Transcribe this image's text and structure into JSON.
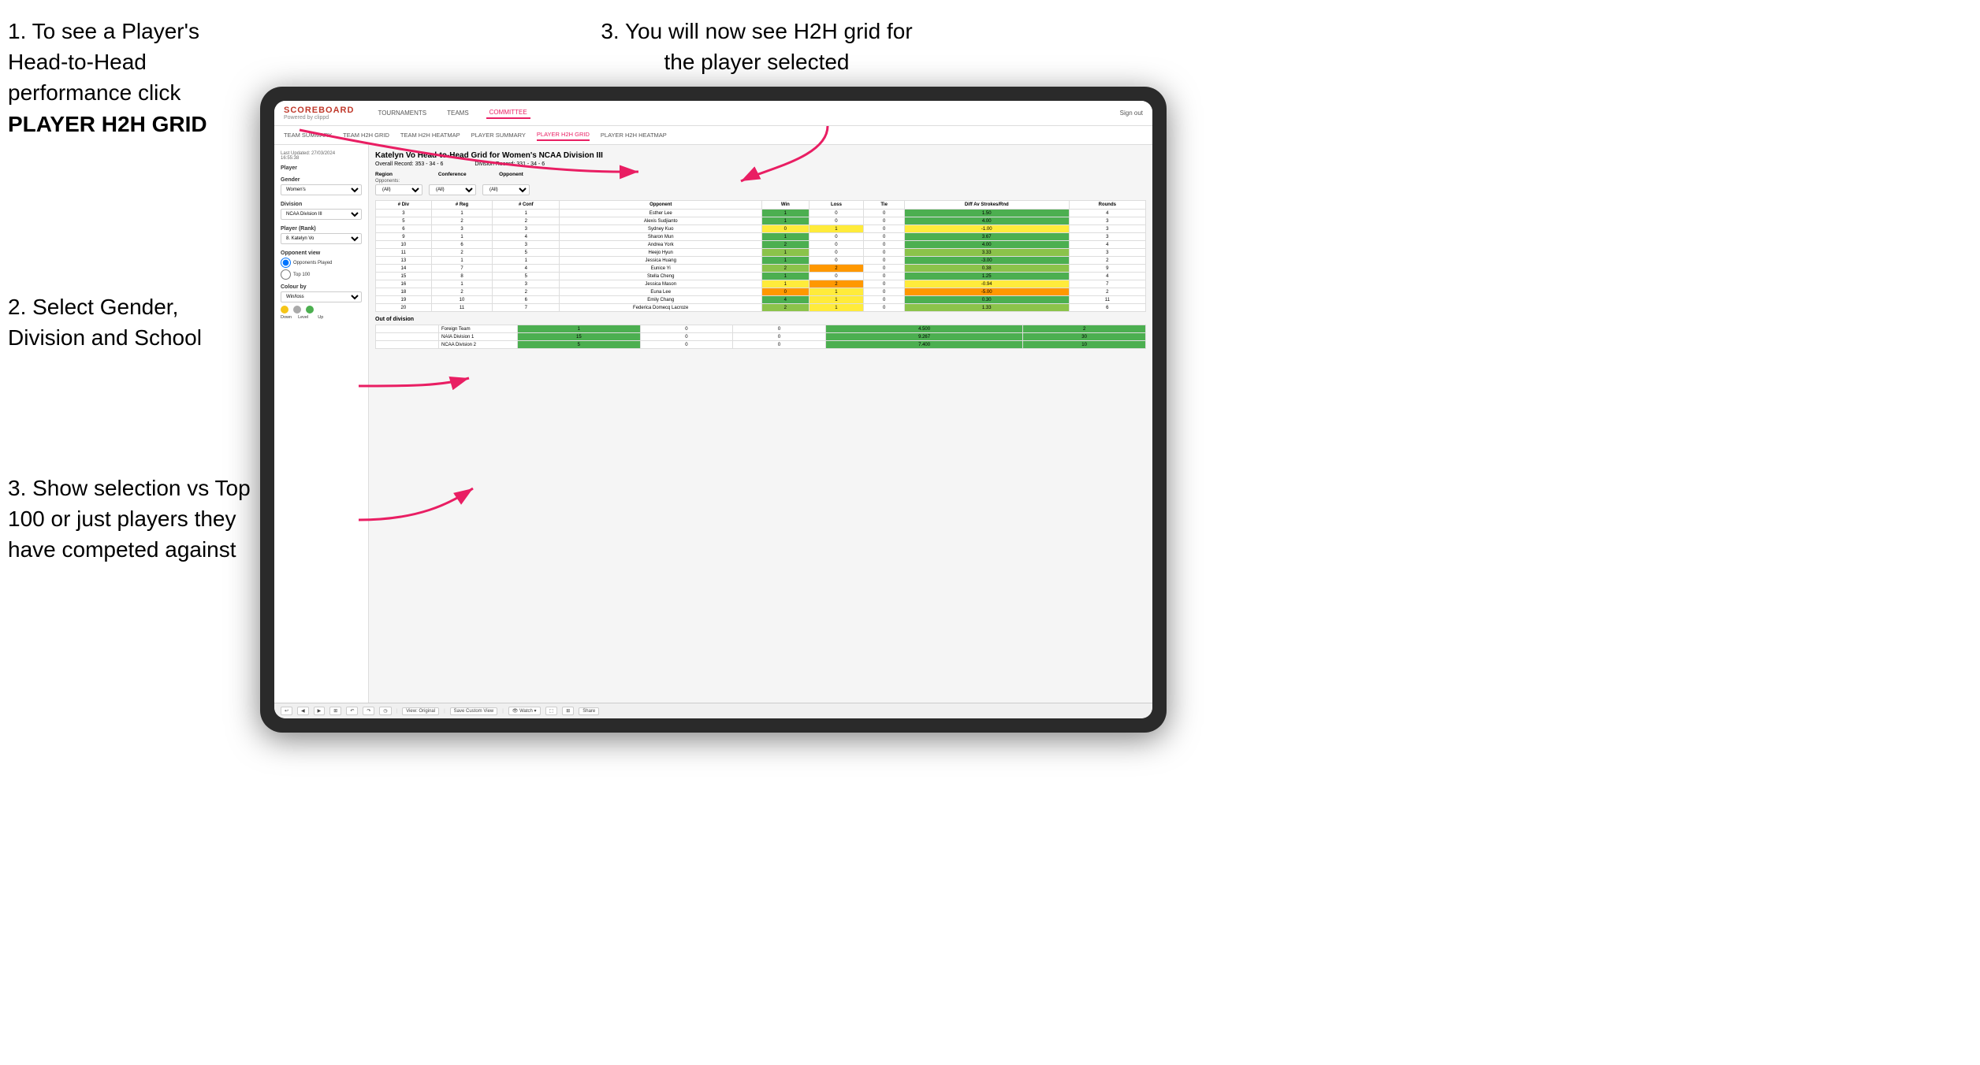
{
  "instructions": {
    "top_left_1": "1. To see a Player's Head-to-Head performance click",
    "top_left_2": "PLAYER H2H GRID",
    "top_right": "3. You will now see H2H grid for the player selected",
    "mid_left": "2. Select Gender, Division and School",
    "bottom_left": "3. Show selection vs Top 100 or just players they have competed against"
  },
  "nav": {
    "brand": "SCOREBOARD",
    "brand_sub": "Powered by clippd",
    "items": [
      "TOURNAMENTS",
      "TEAMS",
      "COMMITTEE"
    ],
    "active": "COMMITTEE",
    "sign_out": "Sign out"
  },
  "sub_nav": {
    "items": [
      "TEAM SUMMARY",
      "TEAM H2H GRID",
      "TEAM H2H HEATMAP",
      "PLAYER SUMMARY",
      "PLAYER H2H GRID",
      "PLAYER H2H HEATMAP"
    ],
    "active": "PLAYER H2H GRID"
  },
  "sidebar": {
    "timestamp": "Last Updated: 27/03/2024",
    "time": "16:55:38",
    "player_label": "Player",
    "gender_label": "Gender",
    "gender_value": "Women's",
    "division_label": "Division",
    "division_value": "NCAA Division III",
    "player_rank_label": "Player (Rank)",
    "player_rank_value": "8. Katelyn Vo",
    "opponent_view_label": "Opponent view",
    "opponent_options": [
      "Opponents Played",
      "Top 100"
    ],
    "colour_label": "Colour by",
    "colour_value": "Win/loss",
    "colour_down": "Down",
    "colour_level": "Level",
    "colour_up": "Up"
  },
  "main": {
    "title": "Katelyn Vo Head-to-Head Grid for Women's NCAA Division III",
    "overall_record": "Overall Record: 353 - 34 - 6",
    "division_record": "Division Record: 331 - 34 - 6",
    "filters": {
      "region_label": "Region",
      "region_opponents": "Opponents:",
      "region_value": "(All)",
      "conference_label": "Conference",
      "conference_value": "(All)",
      "opponent_label": "Opponent",
      "opponent_value": "(All)"
    },
    "table_headers": [
      "#\nDiv",
      "#\nReg",
      "#\nConf",
      "Opponent",
      "Win",
      "Loss",
      "Tie",
      "Diff Av\nStrokes/Rnd",
      "Rounds"
    ],
    "rows": [
      {
        "div": "3",
        "reg": "1",
        "conf": "1",
        "opponent": "Esther Lee",
        "win": 1,
        "loss": 0,
        "tie": 0,
        "diff": 1.5,
        "rounds": 4,
        "win_color": "green"
      },
      {
        "div": "5",
        "reg": "2",
        "conf": "2",
        "opponent": "Alexis Sudjianto",
        "win": 1,
        "loss": 0,
        "tie": 0,
        "diff": 4.0,
        "rounds": 3,
        "win_color": "green"
      },
      {
        "div": "6",
        "reg": "3",
        "conf": "3",
        "opponent": "Sydney Kuo",
        "win": 0,
        "loss": 1,
        "tie": 0,
        "diff": -1.0,
        "rounds": 3,
        "win_color": "yellow"
      },
      {
        "div": "9",
        "reg": "1",
        "conf": "4",
        "opponent": "Sharon Mun",
        "win": 1,
        "loss": 0,
        "tie": 0,
        "diff": 3.67,
        "rounds": 3,
        "win_color": "green"
      },
      {
        "div": "10",
        "reg": "6",
        "conf": "3",
        "opponent": "Andrea York",
        "win": 2,
        "loss": 0,
        "tie": 0,
        "diff": 4.0,
        "rounds": 4,
        "win_color": "green"
      },
      {
        "div": "11",
        "reg": "2",
        "conf": "5",
        "opponent": "Heejo Hyun",
        "win": 1,
        "loss": 0,
        "tie": 0,
        "diff": 3.33,
        "rounds": 3,
        "win_color": "light-green"
      },
      {
        "div": "13",
        "reg": "1",
        "conf": "1",
        "opponent": "Jessica Huang",
        "win": 1,
        "loss": 0,
        "tie": 0,
        "diff": -3.0,
        "rounds": 2,
        "win_color": "green"
      },
      {
        "div": "14",
        "reg": "7",
        "conf": "4",
        "opponent": "Eunice Yi",
        "win": 2,
        "loss": 2,
        "tie": 0,
        "diff": 0.38,
        "rounds": 9,
        "win_color": "light-green"
      },
      {
        "div": "15",
        "reg": "8",
        "conf": "5",
        "opponent": "Stella Cheng",
        "win": 1,
        "loss": 0,
        "tie": 0,
        "diff": 1.25,
        "rounds": 4,
        "win_color": "green"
      },
      {
        "div": "16",
        "reg": "1",
        "conf": "3",
        "opponent": "Jessica Mason",
        "win": 1,
        "loss": 2,
        "tie": 0,
        "diff": -0.94,
        "rounds": 7,
        "win_color": "yellow"
      },
      {
        "div": "18",
        "reg": "2",
        "conf": "2",
        "opponent": "Euna Lee",
        "win": 0,
        "loss": 1,
        "tie": 0,
        "diff": -5.0,
        "rounds": 2,
        "win_color": "orange"
      },
      {
        "div": "19",
        "reg": "10",
        "conf": "6",
        "opponent": "Emily Chang",
        "win": 4,
        "loss": 1,
        "tie": 0,
        "diff": 0.3,
        "rounds": 11,
        "win_color": "green"
      },
      {
        "div": "20",
        "reg": "11",
        "conf": "7",
        "opponent": "Federica Domecq Lacroze",
        "win": 2,
        "loss": 1,
        "tie": 0,
        "diff": 1.33,
        "rounds": 6,
        "win_color": "light-green"
      }
    ],
    "out_of_division_label": "Out of division",
    "out_of_division_rows": [
      {
        "label": "Foreign Team",
        "win": 1,
        "loss": 0,
        "tie": 0,
        "diff": 4.5,
        "rounds": 2
      },
      {
        "label": "NAIA Division 1",
        "win": 15,
        "loss": 0,
        "tie": 0,
        "diff": 9.267,
        "rounds": 30
      },
      {
        "label": "NCAA Division 2",
        "win": 5,
        "loss": 0,
        "tie": 0,
        "diff": 7.4,
        "rounds": 10
      }
    ]
  },
  "toolbar": {
    "buttons": [
      "↩",
      "◀",
      "▶",
      "⊞",
      "↶",
      "↷",
      "◷",
      "View: Original",
      "Save Custom View",
      "👁 Watch ▾",
      "⬚",
      "⊞",
      "Share"
    ]
  }
}
